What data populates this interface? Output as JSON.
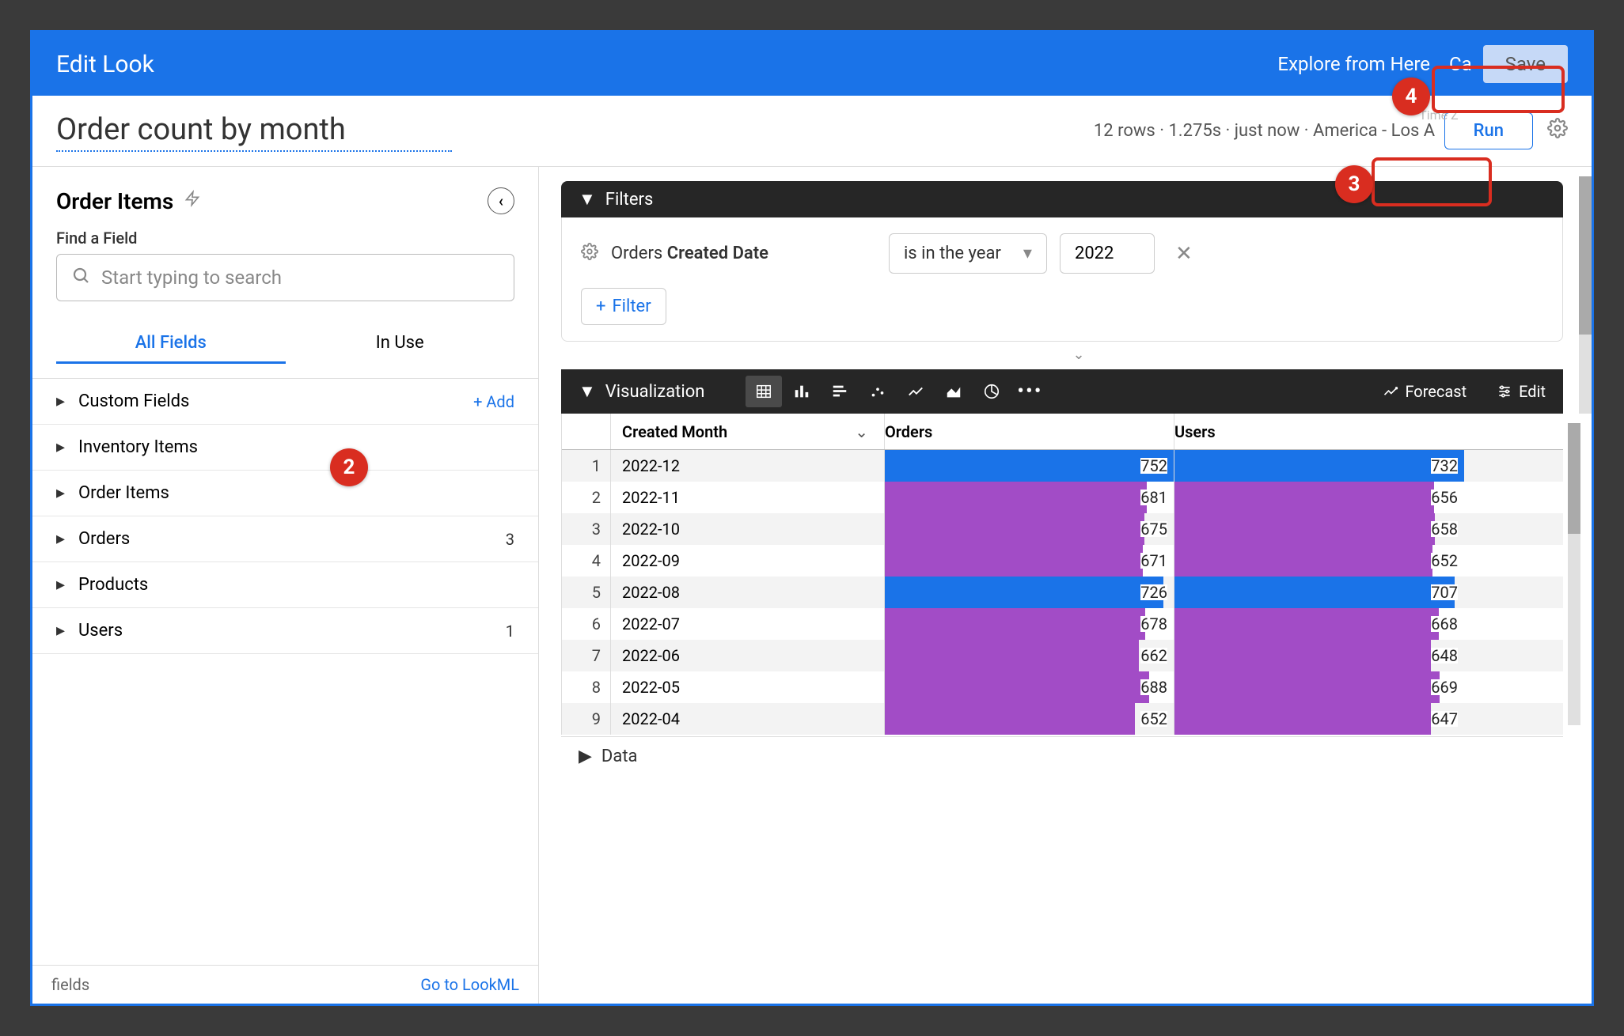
{
  "top_bar": {
    "title": "Edit Look",
    "explore_link": "Explore from Here",
    "cancel_link": "Ca",
    "save_label": "Save"
  },
  "title_row": {
    "look_title": "Order count by month",
    "meta": "12 rows · 1.275s · just now · America - Los A",
    "tz_label": "Time Z",
    "run_label": "Run"
  },
  "sidebar": {
    "explore_name": "Order Items",
    "find_label": "Find a Field",
    "search_placeholder": "Start typing to search",
    "tabs": {
      "all": "All Fields",
      "in_use": "In Use"
    },
    "groups": [
      {
        "label": "Custom Fields",
        "add": "+  Add"
      },
      {
        "label": "Inventory Items"
      },
      {
        "label": "Order Items"
      },
      {
        "label": "Orders",
        "count": "3"
      },
      {
        "label": "Products"
      },
      {
        "label": "Users",
        "count": "1"
      }
    ],
    "footer": {
      "fields": "fields",
      "lookml": "Go to LookML"
    }
  },
  "filters": {
    "header": "Filters",
    "field_prefix": "Orders ",
    "field_bold": "Created Date",
    "op": "is in the year",
    "value": "2022",
    "add_filter": "Filter"
  },
  "viz": {
    "header": "Visualization",
    "forecast": "Forecast",
    "edit": "Edit",
    "columns": {
      "month": "Created Month",
      "orders": "Orders",
      "users": "Users"
    }
  },
  "data_section": {
    "header": "Data"
  },
  "annotations": {
    "a2": "2",
    "a3": "3",
    "a4": "4"
  },
  "chart_data": {
    "type": "table",
    "title": "Order count by month",
    "columns": [
      "Created Month",
      "Orders",
      "Users"
    ],
    "max_orders": 752,
    "max_users": 732,
    "rows": [
      {
        "idx": 1,
        "month": "2022-12",
        "orders": 752,
        "users": 732,
        "blue": true
      },
      {
        "idx": 2,
        "month": "2022-11",
        "orders": 681,
        "users": 656
      },
      {
        "idx": 3,
        "month": "2022-10",
        "orders": 675,
        "users": 658
      },
      {
        "idx": 4,
        "month": "2022-09",
        "orders": 671,
        "users": 652
      },
      {
        "idx": 5,
        "month": "2022-08",
        "orders": 726,
        "users": 707,
        "blue": true
      },
      {
        "idx": 6,
        "month": "2022-07",
        "orders": 678,
        "users": 668
      },
      {
        "idx": 7,
        "month": "2022-06",
        "orders": 662,
        "users": 648
      },
      {
        "idx": 8,
        "month": "2022-05",
        "orders": 688,
        "users": 669
      },
      {
        "idx": 9,
        "month": "2022-04",
        "orders": 652,
        "users": 647
      }
    ]
  }
}
